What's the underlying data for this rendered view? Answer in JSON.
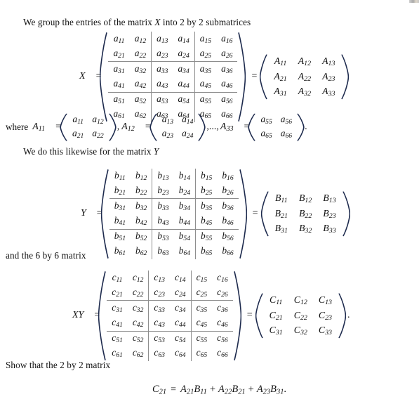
{
  "document": {
    "paragraphs": {
      "intro": "We group the entries of the matrix X into 2 by 2 submatrices",
      "where_prefix": "where",
      "likewise": "We do this likewise for the matrix Y",
      "and6by6": "and the 6 by 6 matrix",
      "show_that": "Show that the 2 by 2 matrix"
    },
    "equations": {
      "eq_X": {
        "lhs": "X",
        "equals": "=",
        "equals2": "=",
        "big_matrix": {
          "entry_base": "a",
          "rows": 6,
          "cols": 6,
          "entries": [
            [
              "a11",
              "a12",
              "a13",
              "a14",
              "a15",
              "a16"
            ],
            [
              "a21",
              "a22",
              "a23",
              "a24",
              "a25",
              "a26"
            ],
            [
              "a31",
              "a32",
              "a33",
              "a34",
              "a35",
              "a36"
            ],
            [
              "a41",
              "a42",
              "a43",
              "a44",
              "a45",
              "a46"
            ],
            [
              "a51",
              "a52",
              "a53",
              "a54",
              "a55",
              "a56"
            ],
            [
              "a61",
              "a62",
              "a63",
              "a64",
              "a65",
              "a66"
            ]
          ]
        },
        "block_matrix": {
          "entry_base": "A",
          "entries": [
            [
              "A11",
              "A12",
              "A13"
            ],
            [
              "A21",
              "A22",
              "A23"
            ],
            [
              "A31",
              "A32",
              "A33"
            ]
          ]
        }
      },
      "eq_where": {
        "item1_label": "A11",
        "item1_equals": "=",
        "item1_matrix": [
          [
            "a11",
            "a12"
          ],
          [
            "a21",
            "a22"
          ]
        ],
        "sep1": ",",
        "item2_label": "A12",
        "item2_equals": "=",
        "item2_matrix": [
          [
            "a13",
            "a14"
          ],
          [
            "a23",
            "a24"
          ]
        ],
        "sep2": ",...,",
        "item3_label": "A33",
        "item3_equals": "=",
        "item3_matrix": [
          [
            "a55",
            "a56"
          ],
          [
            "a65",
            "a66"
          ]
        ],
        "period": "."
      },
      "eq_Y": {
        "lhs": "Y",
        "equals": "=",
        "equals2": "=",
        "big_matrix": {
          "entry_base": "b",
          "entries": [
            [
              "b11",
              "b12",
              "b13",
              "b14",
              "b15",
              "b16"
            ],
            [
              "b21",
              "b22",
              "b23",
              "b24",
              "b25",
              "b26"
            ],
            [
              "b31",
              "b32",
              "b33",
              "b34",
              "b35",
              "b36"
            ],
            [
              "b41",
              "b42",
              "b43",
              "b44",
              "b45",
              "b46"
            ],
            [
              "b51",
              "b52",
              "b53",
              "b54",
              "b55",
              "b56"
            ],
            [
              "b61",
              "b62",
              "b63",
              "b64",
              "b65",
              "b66"
            ]
          ]
        },
        "block_matrix": {
          "entry_base": "B",
          "entries": [
            [
              "B11",
              "B12",
              "B13"
            ],
            [
              "B21",
              "B22",
              "B23"
            ],
            [
              "B31",
              "B32",
              "B33"
            ]
          ]
        }
      },
      "eq_XY": {
        "lhs": "XY",
        "equals": "=",
        "equals2": "=",
        "big_matrix": {
          "entry_base": "c",
          "entries": [
            [
              "c11",
              "c12",
              "c13",
              "c14",
              "c15",
              "c16"
            ],
            [
              "c21",
              "c22",
              "c23",
              "c24",
              "c25",
              "c26"
            ],
            [
              "c31",
              "c32",
              "c33",
              "c34",
              "c35",
              "c36"
            ],
            [
              "c41",
              "c42",
              "c43",
              "c44",
              "c45",
              "c46"
            ],
            [
              "c51",
              "c52",
              "c53",
              "c54",
              "c55",
              "c56"
            ],
            [
              "c61",
              "c62",
              "c63",
              "c64",
              "c65",
              "c66"
            ]
          ]
        },
        "block_matrix": {
          "entry_base": "C",
          "entries": [
            [
              "C11",
              "C12",
              "C13"
            ],
            [
              "C21",
              "C22",
              "C23"
            ],
            [
              "C31",
              "C32",
              "C33"
            ]
          ]
        },
        "period": "."
      },
      "eq_final": {
        "text": "C21 = A21B11 + A22B21 + A23B31.",
        "lhs": "C21",
        "equals": "=",
        "term1": "A21B11",
        "plus1": "+",
        "term2": "A22B21",
        "plus2": "+",
        "term3": "A23B31",
        "period": "."
      }
    }
  },
  "colors": {
    "text": "#111111",
    "paren": "#1d2a4d",
    "rule": "#8d8d8d",
    "background": "#ffffff"
  }
}
